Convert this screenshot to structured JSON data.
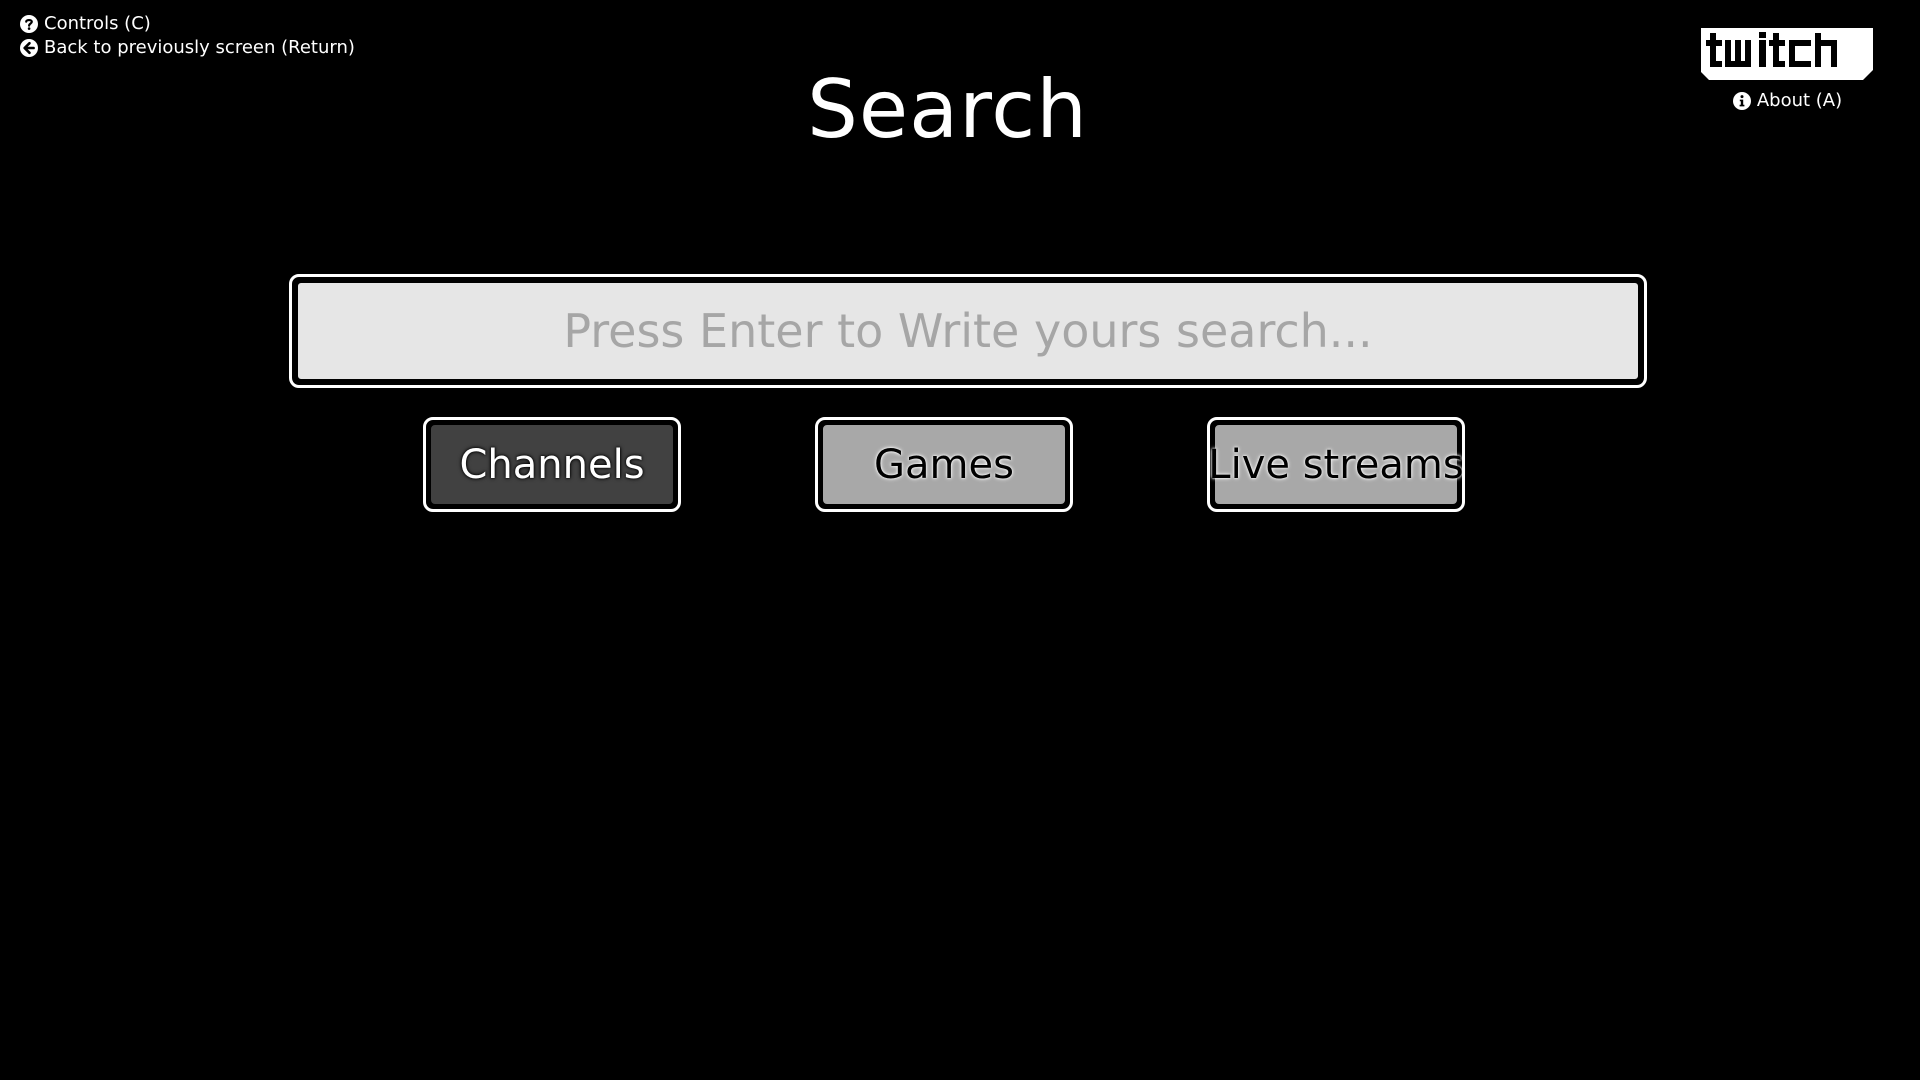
{
  "hints": {
    "controls_label": "Controls (C)",
    "back_label": "Back to previously screen (Return)"
  },
  "header": {
    "title": "Search",
    "logo_icon": "twitch-logo-icon",
    "about_label": "About (A)"
  },
  "search": {
    "placeholder": "Press Enter to Write yours search..."
  },
  "categories": [
    {
      "label": "Channels",
      "selected": true
    },
    {
      "label": "Games",
      "selected": false
    },
    {
      "label": "Live streams",
      "selected": false
    }
  ],
  "colors": {
    "background": "#000000",
    "foreground": "#ffffff",
    "search_field": "#e6e6e6",
    "placeholder_text": "#a6a6a6",
    "button_selected": "#414141",
    "button_unselected": "#a8a8a8"
  }
}
